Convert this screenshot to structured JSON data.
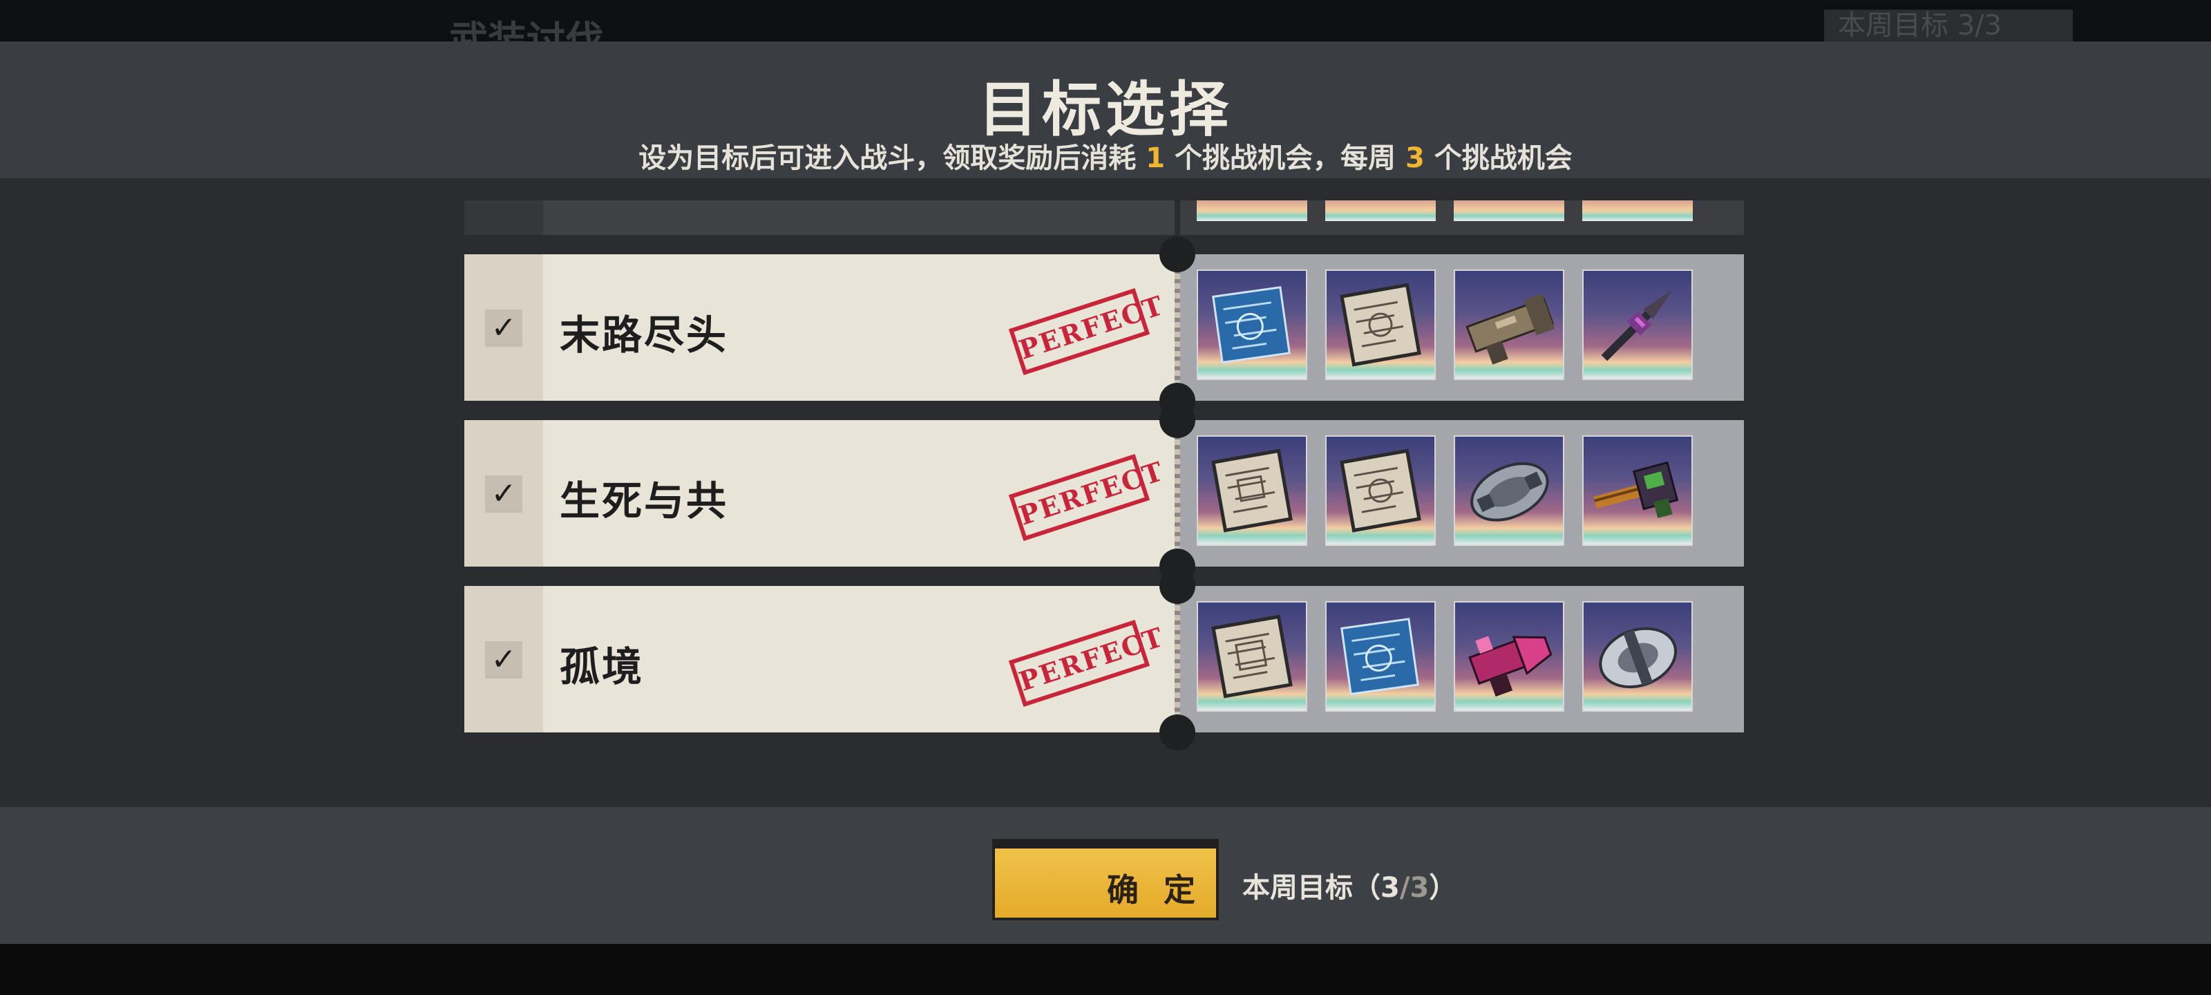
{
  "background": {
    "ghost_title": "武装讨伐",
    "ghost_weekly": "本周目标 3/3"
  },
  "header": {
    "title": "目标选择",
    "subtitle_part1": "设为目标后可进入战斗，领取奖励后消耗",
    "subtitle_num1": "1",
    "subtitle_part2": "个挑战机会，每周",
    "subtitle_num2": "3",
    "subtitle_part3": "个挑战机会"
  },
  "targets": [
    {
      "name": "末路尽头",
      "checked": true,
      "stamp": "PERFECT",
      "rewards": [
        "blueprint-blue-icon",
        "blueprint-paper-icon",
        "cannon-part-icon",
        "blade-weapon-icon"
      ]
    },
    {
      "name": "生死与共",
      "checked": true,
      "stamp": "PERFECT",
      "rewards": [
        "blueprint-paper-icon",
        "blueprint-paper-icon",
        "armor-plate-icon",
        "gatling-gun-icon"
      ]
    },
    {
      "name": "孤境",
      "checked": true,
      "stamp": "PERFECT",
      "rewards": [
        "blueprint-paper-icon",
        "blueprint-blue-icon",
        "mech-arm-icon",
        "shield-part-icon"
      ]
    }
  ],
  "footer": {
    "confirm_label": "确 定",
    "weekly_label": "本周目标（",
    "weekly_current": "3",
    "weekly_sep": "/",
    "weekly_total": "3",
    "weekly_close": "）"
  },
  "colors": {
    "accent_yellow": "#f0b632",
    "stamp_red": "#c8243a",
    "card_bg": "#e9e4d8",
    "panel_bg": "#3a3e42"
  }
}
